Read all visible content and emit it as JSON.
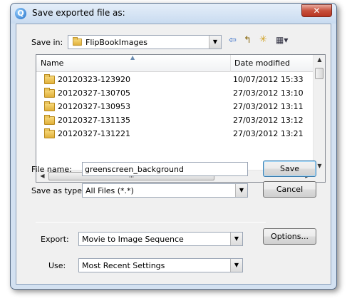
{
  "window": {
    "title": "Save exported file as:",
    "app_icon_glyph": "Q",
    "close_glyph": "✕"
  },
  "save_in": {
    "label": "Save in:",
    "value": "FlipBookImages"
  },
  "toolbar": {
    "back_glyph": "⇦",
    "up_glyph": "↰",
    "new_folder_glyph": "✳",
    "views_glyph": "▦▾"
  },
  "file_list": {
    "columns": [
      "Name",
      "Date modified"
    ],
    "rows": [
      {
        "name": "20120323-123920",
        "date": "10/07/2012 15:33"
      },
      {
        "name": "20120327-130705",
        "date": "27/03/2012 13:10"
      },
      {
        "name": "20120327-130953",
        "date": "27/03/2012 13:11"
      },
      {
        "name": "20120327-131135",
        "date": "27/03/2012 13:12"
      },
      {
        "name": "20120327-131221",
        "date": "27/03/2012 13:21"
      }
    ],
    "hscroll_grip": "III"
  },
  "file_name": {
    "label": "File name:",
    "value": "greenscreen_background"
  },
  "save_as_type": {
    "label": "Save as type:",
    "value": "All Files (*.*)"
  },
  "buttons": {
    "save": "Save",
    "cancel": "Cancel",
    "options": "Options..."
  },
  "export": {
    "label": "Export:",
    "value": "Movie to Image Sequence"
  },
  "use": {
    "label": "Use:",
    "value": "Most Recent Settings"
  },
  "colors": {
    "frame": "#d3e1f1",
    "client": "#f0f0f0",
    "close_button": "#c7503c",
    "folder": "#e0b03a"
  }
}
